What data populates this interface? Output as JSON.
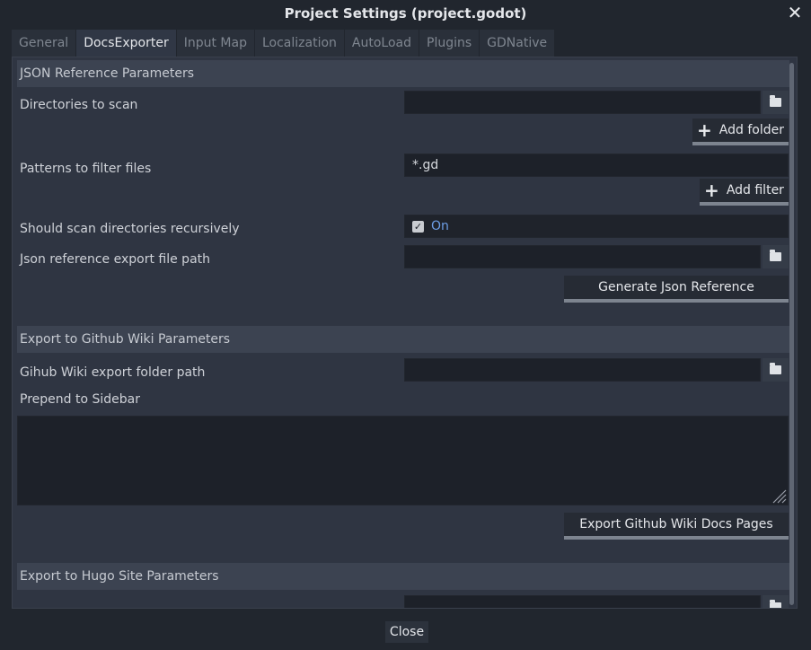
{
  "window": {
    "title": "Project Settings (project.godot)",
    "close_glyph": "✕"
  },
  "tabs": [
    {
      "label": "General",
      "active": false
    },
    {
      "label": "DocsExporter",
      "active": true
    },
    {
      "label": "Input Map",
      "active": false
    },
    {
      "label": "Localization",
      "active": false
    },
    {
      "label": "AutoLoad",
      "active": false
    },
    {
      "label": "Plugins",
      "active": false
    },
    {
      "label": "GDNative",
      "active": false
    }
  ],
  "json_section": {
    "header": "JSON Reference Parameters",
    "directories_label": "Directories to scan",
    "directories_value": "",
    "add_folder_label": "Add folder",
    "patterns_label": "Patterns to filter files",
    "patterns_value": "*.gd",
    "add_filter_label": "Add filter",
    "recursive_label": "Should scan directories recursively",
    "recursive_value": "On",
    "export_path_label": "Json reference export file path",
    "export_path_value": "",
    "generate_label": "Generate Json Reference"
  },
  "wiki_section": {
    "header": "Export to Github Wiki Parameters",
    "folder_label": "Gihub Wiki export folder path",
    "folder_value": "",
    "prepend_label": "Prepend to Sidebar",
    "prepend_value": "",
    "export_label": "Export Github Wiki Docs Pages"
  },
  "hugo_section": {
    "header": "Export to Hugo Site Parameters"
  },
  "footer": {
    "close_label": "Close"
  },
  "colors": {
    "background": "#21262e",
    "panel": "#2f3542",
    "section_header": "#3c4351",
    "field": "#1d2129",
    "accent_on": "#6d9ee6"
  },
  "icons": [
    "close-icon",
    "folder-icon",
    "plus-icon",
    "checkbox-icon",
    "resize-grip-icon"
  ]
}
